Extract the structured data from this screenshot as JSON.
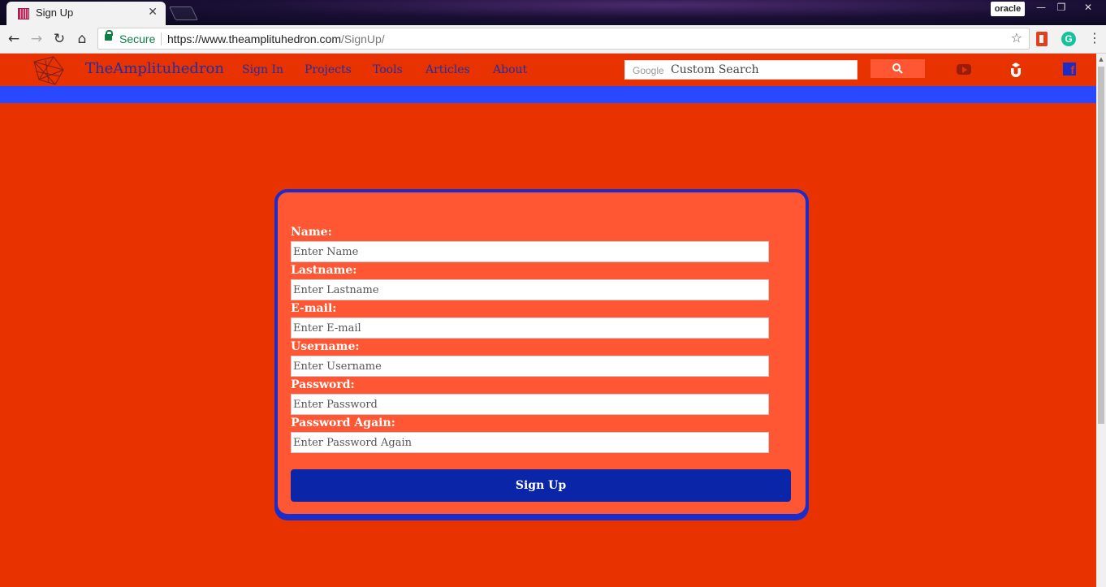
{
  "browser": {
    "tab_title": "Sign Up",
    "tab_close": "✕",
    "profile": "oracle",
    "window_controls": {
      "minimize": "—",
      "restore": "❐",
      "close": "✕"
    },
    "nav": {
      "back": "←",
      "forward": "→",
      "reload": "↻",
      "home": "⌂"
    },
    "secure_label": "Secure",
    "url_host": "https://www.theamplituhedron.com",
    "url_path": "/SignUp/",
    "star": "☆",
    "menu": "⋮",
    "grammarly": "G",
    "scroll_up": "▲"
  },
  "site": {
    "brand": "TheAmplituhedron",
    "nav": [
      "Sign In",
      "Projects",
      "Tools",
      "Articles",
      "About"
    ],
    "search": {
      "brand": "Google",
      "placeholder": "Custom Search"
    },
    "icons": [
      "search-icon",
      "youtube-icon",
      "udemy-icon",
      "facebook-icon"
    ],
    "colors": {
      "page_bg": "#e83200",
      "strip": "#2948ff",
      "card_bg": "#ff5733",
      "card_border": "#1a2cc9",
      "button": "#0b25a8",
      "link": "#1d2fa8"
    }
  },
  "form": {
    "fields": [
      {
        "label": "Name:",
        "placeholder": "Enter Name"
      },
      {
        "label": "Lastname:",
        "placeholder": "Enter Lastname"
      },
      {
        "label": "E-mail:",
        "placeholder": "Enter E-mail"
      },
      {
        "label": "Username:",
        "placeholder": "Enter Username"
      },
      {
        "label": "Password:",
        "placeholder": "Enter Password"
      },
      {
        "label": "Password Again:",
        "placeholder": "Enter Password Again"
      }
    ],
    "submit_label": "Sign Up"
  }
}
